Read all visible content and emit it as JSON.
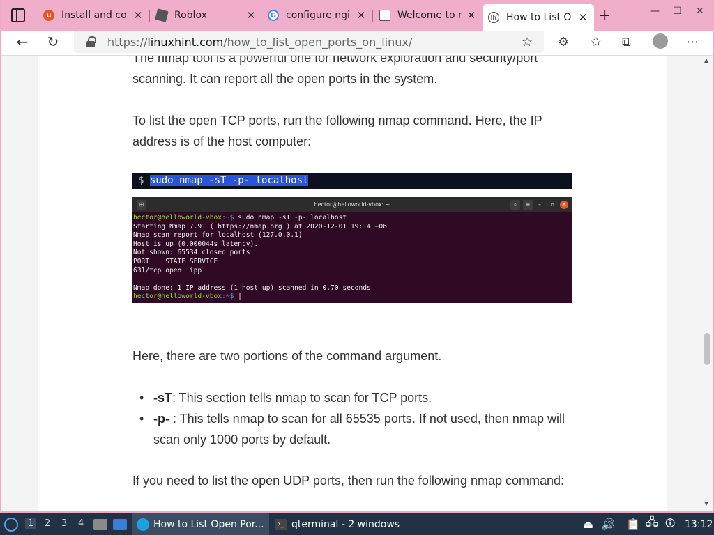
{
  "tabs": [
    {
      "title": "Install and co",
      "favicon_color": "#e95420"
    },
    {
      "title": "Roblox",
      "favicon_color": "#555555"
    },
    {
      "title": "configure ngin",
      "favicon_color": "#4285f4"
    },
    {
      "title": "Welcome to n",
      "favicon_color": "#666666"
    },
    {
      "title": "How to List O",
      "favicon_color": "#444444"
    }
  ],
  "address": {
    "scheme": "https://",
    "host": "linuxhint.com",
    "path": "/how_to_list_open_ports_on_linux/"
  },
  "article": {
    "para1_line1": "The nmap tool is a powerful one for network exploration and security/port",
    "para1_line2": "scanning. It can report all the open ports in the system.",
    "para2_line1": "To list the open TCP ports, run the following nmap command. Here, the IP",
    "para2_line2": "address is of the host computer:",
    "code_prompt": "$",
    "code_command": "sudo nmap -sT -p- localhost",
    "para3": "Here, there are two portions of the command argument.",
    "bullet1_flag": "-sT",
    "bullet1_text": ": This section tells nmap to scan for TCP ports.",
    "bullet2_flag": "-p-",
    "bullet2_line1": " : This tells nmap to scan for all 65535 ports. If not used, then nmap will",
    "bullet2_line2": "scan only 1000 ports by default.",
    "para4": "If you need to list the open UDP ports, then run the following nmap command:"
  },
  "terminal": {
    "title": "hector@helloworld-vbox: ~",
    "user_host": "hector@helloworld-vbox",
    "path_prompt": ":~$",
    "cmd": " sudo nmap -sT -p- localhost",
    "lines": [
      "Starting Nmap 7.91 ( https://nmap.org ) at 2020-12-01 19:14 +06",
      "Nmap scan report for localhost (127.0.0.1)",
      "Host is up (0.000044s latency).",
      "Not shown: 65534 closed ports",
      "PORT    STATE SERVICE",
      "631/tcp open  ipp",
      "",
      "Nmap done: 1 IP address (1 host up) scanned in 0.70 seconds"
    ],
    "final_prompt": " |"
  },
  "taskbar": {
    "workspaces": [
      "1",
      "2",
      "3",
      "4"
    ],
    "task1": "How to List Open Por...",
    "task2": "qterminal - 2 windows",
    "clock": "13:12"
  }
}
